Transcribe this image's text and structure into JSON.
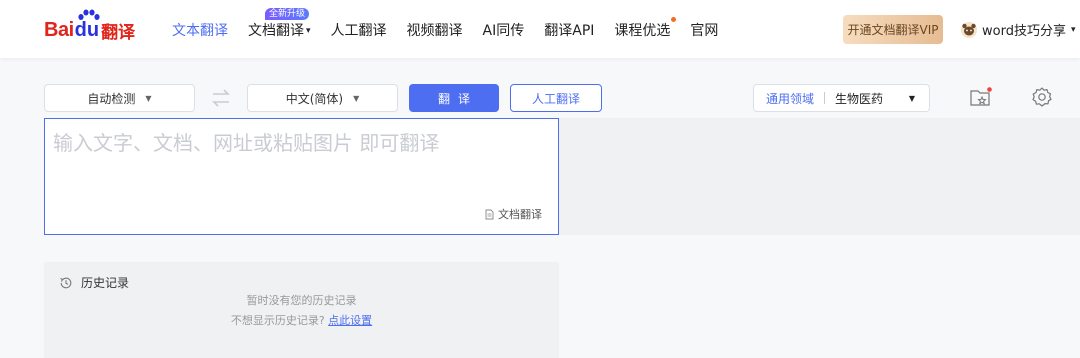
{
  "logo": {
    "bai": "Bai",
    "du": "du",
    "fanyi": "翻译"
  },
  "nav": {
    "items": [
      {
        "label": "文本翻译",
        "active": true
      },
      {
        "label": "文档翻译",
        "badge": "全新升级",
        "dropdown": true
      },
      {
        "label": "人工翻译"
      },
      {
        "label": "视频翻译"
      },
      {
        "label": "AI同传"
      },
      {
        "label": "翻译API"
      },
      {
        "label": "课程优选",
        "dot": true
      },
      {
        "label": "官网"
      }
    ],
    "caret": "▾"
  },
  "header": {
    "vip_label": "开通文档翻译VIP",
    "username": "word技巧分享",
    "caret": "▾"
  },
  "toolbar": {
    "source_lang": "自动检测",
    "target_lang": "中文(简体)",
    "arrow": "▼",
    "translate_label": "翻译",
    "human_label": "人工翻译",
    "domain_general": "通用领域",
    "domain_field": "生物医药"
  },
  "input": {
    "placeholder": "输入文字、文档、网址或粘贴图片 即可翻译",
    "doc_translate": "文档翻译"
  },
  "history": {
    "title": "历史记录",
    "empty": "暂时没有您的历史记录",
    "hint_prefix": "不想显示历史记录?",
    "hint_link": "点此设置"
  },
  "colors": {
    "accent": "#4e6ef2",
    "brand_red": "#e1251b",
    "brand_blue": "#2932e1",
    "vip_gold": "#e6bc92"
  }
}
